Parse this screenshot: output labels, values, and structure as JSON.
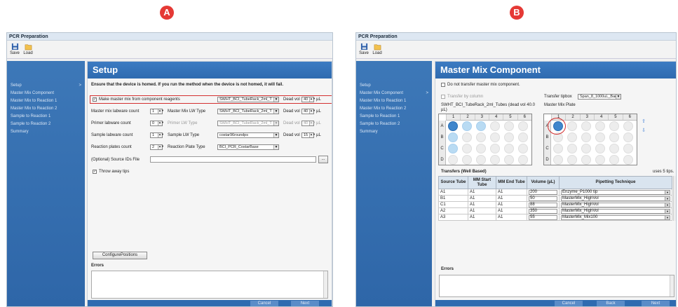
{
  "badges": {
    "a": "A",
    "b": "B"
  },
  "window": {
    "title": "PCR Preparation"
  },
  "toolbar": {
    "save": "Save",
    "load": "Load"
  },
  "sidebar": {
    "items": [
      "Setup",
      "Master Mix Component",
      "Master Mix to Reaction 1",
      "Master Mix to Reaction 2",
      "Sample to Reaction 1",
      "Sample to Reaction 2",
      "Summary"
    ],
    "chevron": ">"
  },
  "panelA": {
    "heading": "Setup",
    "notice": "Ensure that the device is homed. If you run the method when the device is not homed, it will fail.",
    "make_mm_label": "Make master mix from component reagents",
    "make_mm_checked": "✓",
    "make_mm_select": "SWHT_BCI_TubeRack_2ml_T",
    "dead_vol_label": "Dead vol",
    "dead_vol_1": "40",
    "unit": "µL",
    "rows": [
      {
        "label": "Master mix labware count",
        "count": "1",
        "lw_label": "Master Mix LW Type",
        "lw_value": "SWHT_BCI_TubeRack_2ml_T",
        "dead": "40"
      },
      {
        "label": "Primer labware count",
        "count": "0",
        "lw_label": "Primer LW Type",
        "lw_value": "SWHT_BCI_TubeRack_2ml_T",
        "dead": "40"
      },
      {
        "label": "Sample labware count",
        "count": "1",
        "lw_label": "Sample LW Type",
        "lw_value": "costar96roundps",
        "dead": "15"
      },
      {
        "label": "Reaction plates count",
        "count": "2",
        "lw_label": "Reaction Plate Type",
        "lw_value": "BCI_PCR_CostarBase",
        "dead": ""
      }
    ],
    "source_ids_label": "(Optional) Source IDs File",
    "browse": "...",
    "throw_away": "Throw away tips",
    "throw_away_checked": "✓",
    "config_btn": "ConfigurePositions",
    "errors_label": "Errors",
    "cancel": "Cancel",
    "next": "Next"
  },
  "panelB": {
    "heading": "Master Mix Component",
    "no_transfer": "Do not transfer master mix component.",
    "transfer_by_column": "Transfer by column",
    "transfer_tipbox_label": "Transfer tipbox",
    "transfer_tipbox_value": "Span_8_1000uL_Barr",
    "left_plate_label": "SWHT_BCI_TubeRack_2ml_Tubes (dead vol 40.0 µL)",
    "right_plate_label": "Master Mix Plate",
    "plate_cols": [
      "1",
      "2",
      "3",
      "4",
      "5",
      "6"
    ],
    "plate_rows": [
      "A",
      "B",
      "C",
      "D"
    ],
    "transfers_title": "Transfers (Well Based)",
    "uses_tips": "uses 5 tips.",
    "columns": [
      "Source Tube",
      "MM Start Tube",
      "MM End Tube",
      "Volume (µL)",
      "Pipetting Technique"
    ],
    "transfers": [
      {
        "src": "A1",
        "start": "A1",
        "end": "A1",
        "vol": "200",
        "tech": "Enzyme_P1000 tip"
      },
      {
        "src": "B1",
        "start": "A1",
        "end": "A1",
        "vol": "50",
        "tech": "MasterMix_HighVol"
      },
      {
        "src": "C1",
        "start": "A1",
        "end": "A1",
        "vol": "88",
        "tech": "MasterMix_HighVol"
      },
      {
        "src": "A2",
        "start": "A1",
        "end": "A1",
        "vol": "350",
        "tech": "MasterMix_HighVol"
      },
      {
        "src": "A3",
        "start": "A1",
        "end": "A1",
        "vol": "55",
        "tech": "MasterMix_Mix100"
      }
    ],
    "errors_label": "Errors",
    "cancel": "Cancel",
    "back": "Back",
    "next": "Next"
  },
  "colors": {
    "accent": "#2f6bb0",
    "sidebar": "#3d78b8",
    "highlight": "#d32f2f",
    "well_light": "#b9dbf3",
    "well_dark": "#3f86cc"
  }
}
